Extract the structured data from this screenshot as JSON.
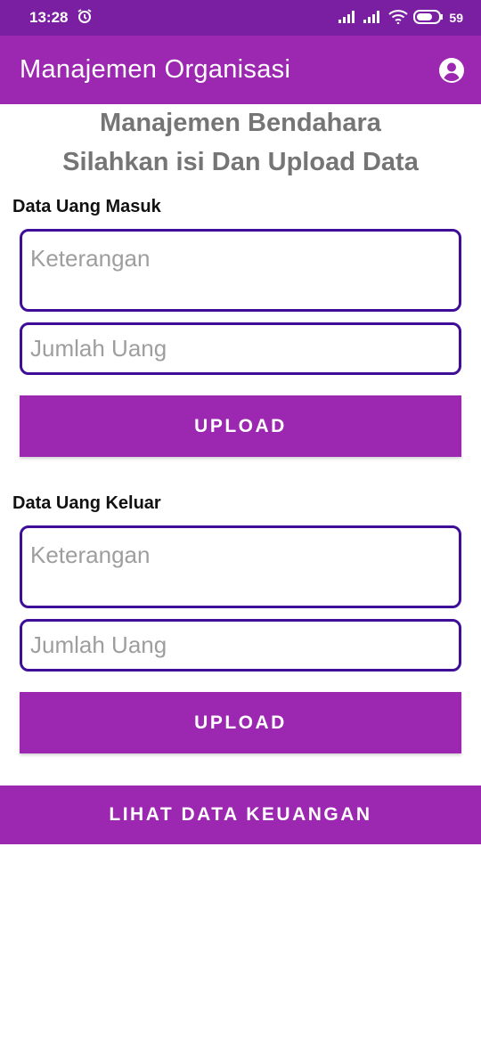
{
  "status_bar": {
    "time": "13:28",
    "battery": "59"
  },
  "app_bar": {
    "title": "Manajemen Organisasi"
  },
  "header": {
    "line1": "Manajemen Bendahara",
    "line2": "Silahkan isi Dan Upload Data"
  },
  "income": {
    "label": "Data Uang Masuk",
    "description_placeholder": "Keterangan",
    "amount_placeholder": "Jumlah Uang",
    "upload_label": "UPLOAD"
  },
  "expense": {
    "label": "Data Uang Keluar",
    "description_placeholder": "Keterangan",
    "amount_placeholder": "Jumlah Uang",
    "upload_label": "UPLOAD"
  },
  "view_button": {
    "label": "LIHAT DATA KEUANGAN"
  },
  "colors": {
    "primary": "#9c27b0",
    "status_bar": "#7b1fa2",
    "field_border": "#3f0e99"
  }
}
